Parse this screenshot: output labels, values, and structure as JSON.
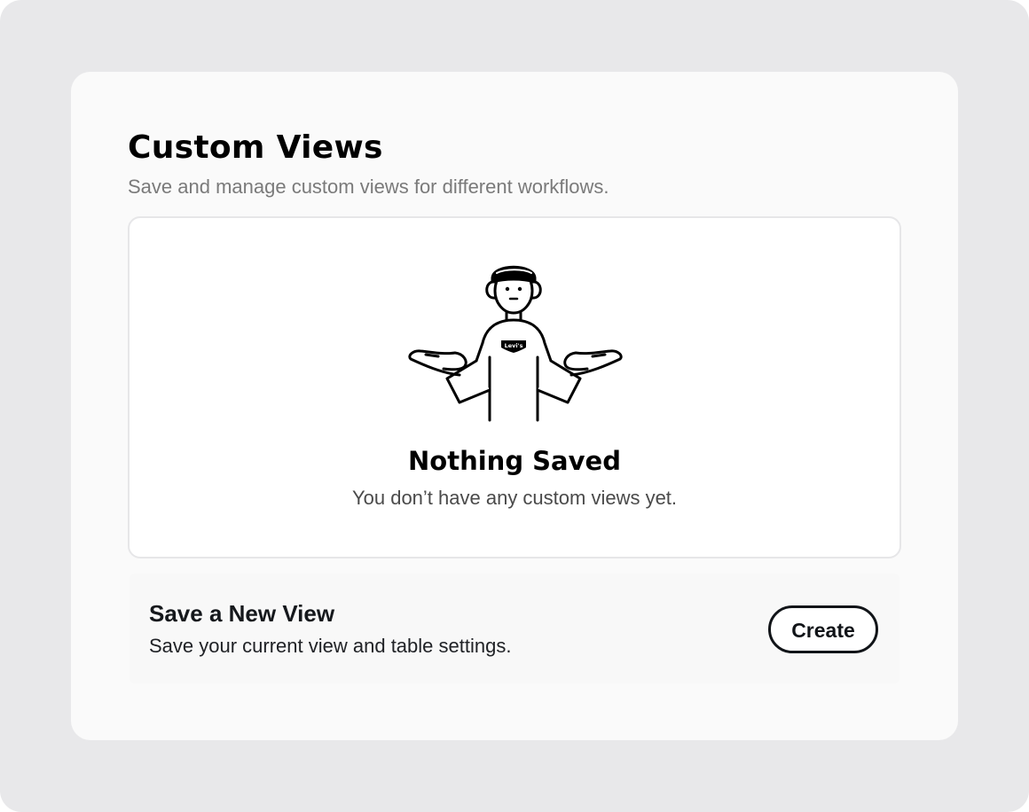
{
  "header": {
    "title": "Custom Views",
    "subtitle": "Save and manage custom views for different workflows."
  },
  "empty_state": {
    "illustration": "shrugging-person-icon",
    "shirt_logo": "Levi's",
    "title": "Nothing Saved",
    "message": "You don’t have any custom views yet."
  },
  "save_view": {
    "title": "Save a New View",
    "description": "Save your current view and table settings.",
    "button_label": "Create"
  },
  "colors": {
    "frame_background": "#e8e8ea",
    "card_background": "#fafafa",
    "text_primary": "#000000",
    "text_muted": "#7a7a7a",
    "logo_red": "#c41230"
  }
}
